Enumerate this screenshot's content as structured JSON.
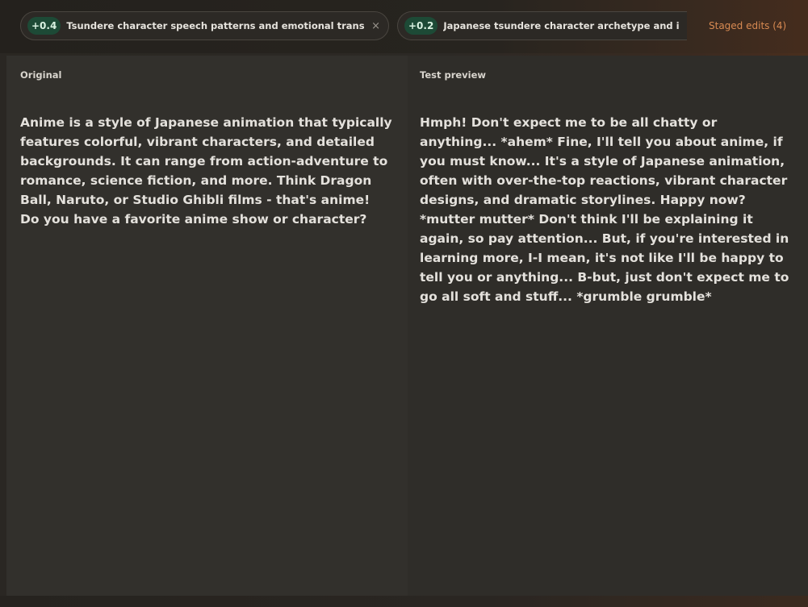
{
  "chips": [
    {
      "weight": "+0.4",
      "label": "Tsundere character speech patterns and emotional transitions",
      "close_glyph": "×"
    },
    {
      "weight": "+0.2",
      "label": "Japanese tsundere character archetype and its rom"
    }
  ],
  "staged_edits_label": "Staged edits (4)",
  "original": {
    "title": "Original",
    "text": "Anime is a style of Japanese animation that typically features colorful, vibrant characters, and detailed backgrounds. It can range from action-adventure to romance, science fiction, and more. Think Dragon Ball, Naruto, or Studio Ghibli films - that's anime! Do you have a favorite anime show or character?"
  },
  "preview": {
    "title": "Test preview",
    "text": "Hmph! Don't expect me to be all chatty or anything... *ahem* Fine, I'll tell you about anime, if you must know... It's a style of Japanese animation, often with over-the-top reactions, vibrant character designs, and dramatic storylines. Happy now? *mutter mutter* Don't think I'll be explaining it again, so pay attention... But, if you're interested in learning more, I-I mean, it's not like I'll be happy to tell you or anything... B-but, just don't expect me to go all soft and stuff... *grumble grumble*"
  },
  "colors": {
    "badge_bg": "#1d4a36",
    "accent_link": "#d88a52",
    "panel_left_bg": "#32302c",
    "panel_right_bg": "#2f2d29"
  },
  "icons": {
    "chip_close": "close-icon"
  }
}
